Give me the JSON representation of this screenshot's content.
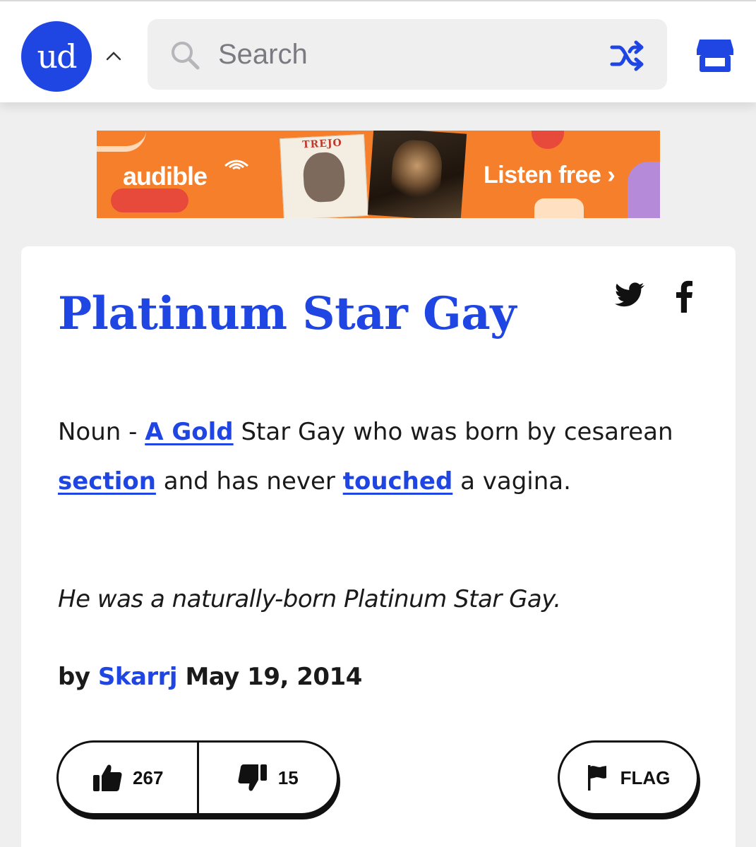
{
  "header": {
    "logo_text": "ud",
    "search_placeholder": "Search",
    "icons": [
      "chevron-up-icon",
      "search-icon",
      "shuffle-icon",
      "store-icon"
    ]
  },
  "ad": {
    "brand": "audible",
    "book_title": "TREJO",
    "cta": "Listen free ›"
  },
  "definition": {
    "word": "Platinum Star Gay",
    "meaning_parts": {
      "p1": "Noun - ",
      "link1": "A Gold",
      "p2": " Star Gay who was born by cesarean ",
      "link2": "section",
      "p3": " and has never ",
      "link3": "touched",
      "p4": " a vagina."
    },
    "example": "He was a naturally-born Platinum Star Gay.",
    "by_label": "by",
    "author": "Skarrj",
    "date": "May 19, 2014",
    "upvotes": "267",
    "downvotes": "15",
    "flag_label": "FLAG"
  },
  "colors": {
    "brand_blue": "#1f45e3",
    "ad_orange": "#f57f2a",
    "background": "#efeff0"
  }
}
